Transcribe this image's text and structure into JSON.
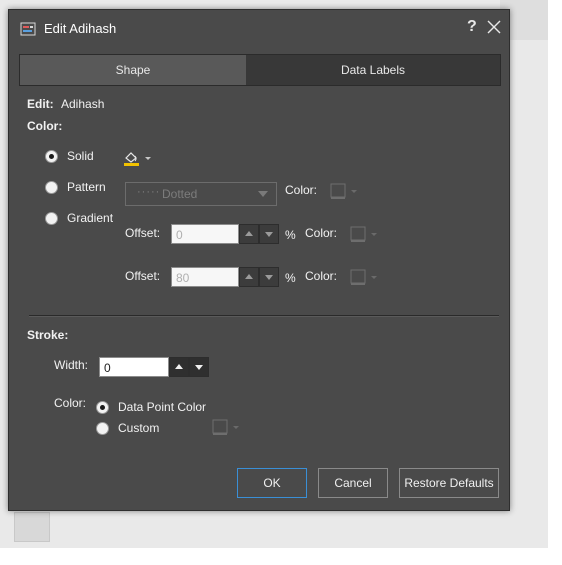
{
  "dialog": {
    "title": "Edit Adihash"
  },
  "tabs": [
    {
      "label": "Shape"
    },
    {
      "label": "Data Labels"
    }
  ],
  "edit": {
    "label": "Edit:",
    "value": "Adihash"
  },
  "color_section": {
    "label": "Color:",
    "options": {
      "solid": "Solid",
      "pattern": "Pattern",
      "gradient": "Gradient"
    },
    "selected": "Solid",
    "fill_swatch_color": "#f2c200",
    "pattern": {
      "value": "Dotted",
      "color_label": "Color:"
    },
    "gradient": {
      "offset1": {
        "label": "Offset:",
        "value": "0",
        "unit": "%",
        "color_label": "Color:"
      },
      "offset2": {
        "label": "Offset:",
        "value": "80",
        "unit": "%",
        "color_label": "Color:"
      }
    }
  },
  "stroke": {
    "label": "Stroke:",
    "width_label": "Width:",
    "width_value": "0",
    "color_label": "Color:",
    "options": {
      "data_point": "Data Point Color",
      "custom": "Custom"
    },
    "selected": "Data Point Color"
  },
  "buttons": {
    "ok": "OK",
    "cancel": "Cancel",
    "restore": "Restore Defaults"
  },
  "colors": {
    "dialog_bg": "#4a4a4a",
    "accent": "#3a8fd6",
    "active_tab": "#595959"
  }
}
